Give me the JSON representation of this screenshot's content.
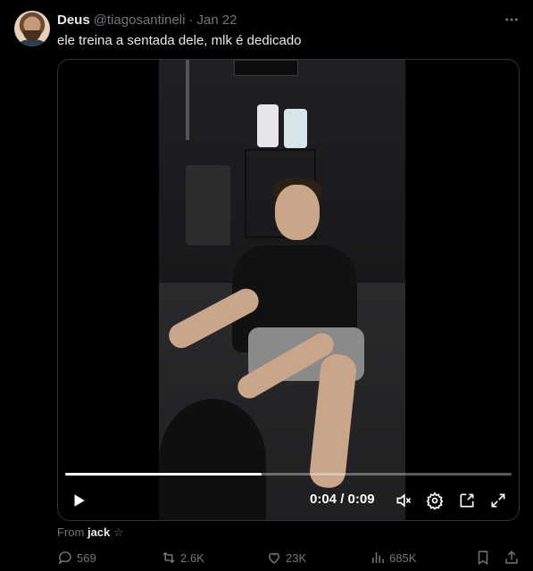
{
  "tweet": {
    "author_name": "Deus",
    "author_handle": "@tiagosantineli",
    "separator": "·",
    "date": "Jan 22",
    "text": "ele treina a sentada dele, mlk é dedicado"
  },
  "video": {
    "current_time": "0:04",
    "duration": "0:09",
    "time_display": "0:04 / 0:09",
    "progress": 0.44
  },
  "from_label": "From",
  "from_user": "jack",
  "actions": {
    "replies": "569",
    "retweets": "2.6K",
    "likes": "23K",
    "views": "685K"
  },
  "icons": {
    "more": "more-dots-icon",
    "play": "play-icon",
    "mute": "mute-icon",
    "settings": "gear-icon",
    "pip": "picture-in-picture-icon",
    "fullscreen": "fullscreen-icon",
    "reply": "reply-icon",
    "retweet": "retweet-icon",
    "like": "heart-icon",
    "views": "views-icon",
    "bookmark": "bookmark-icon",
    "share": "share-icon"
  }
}
